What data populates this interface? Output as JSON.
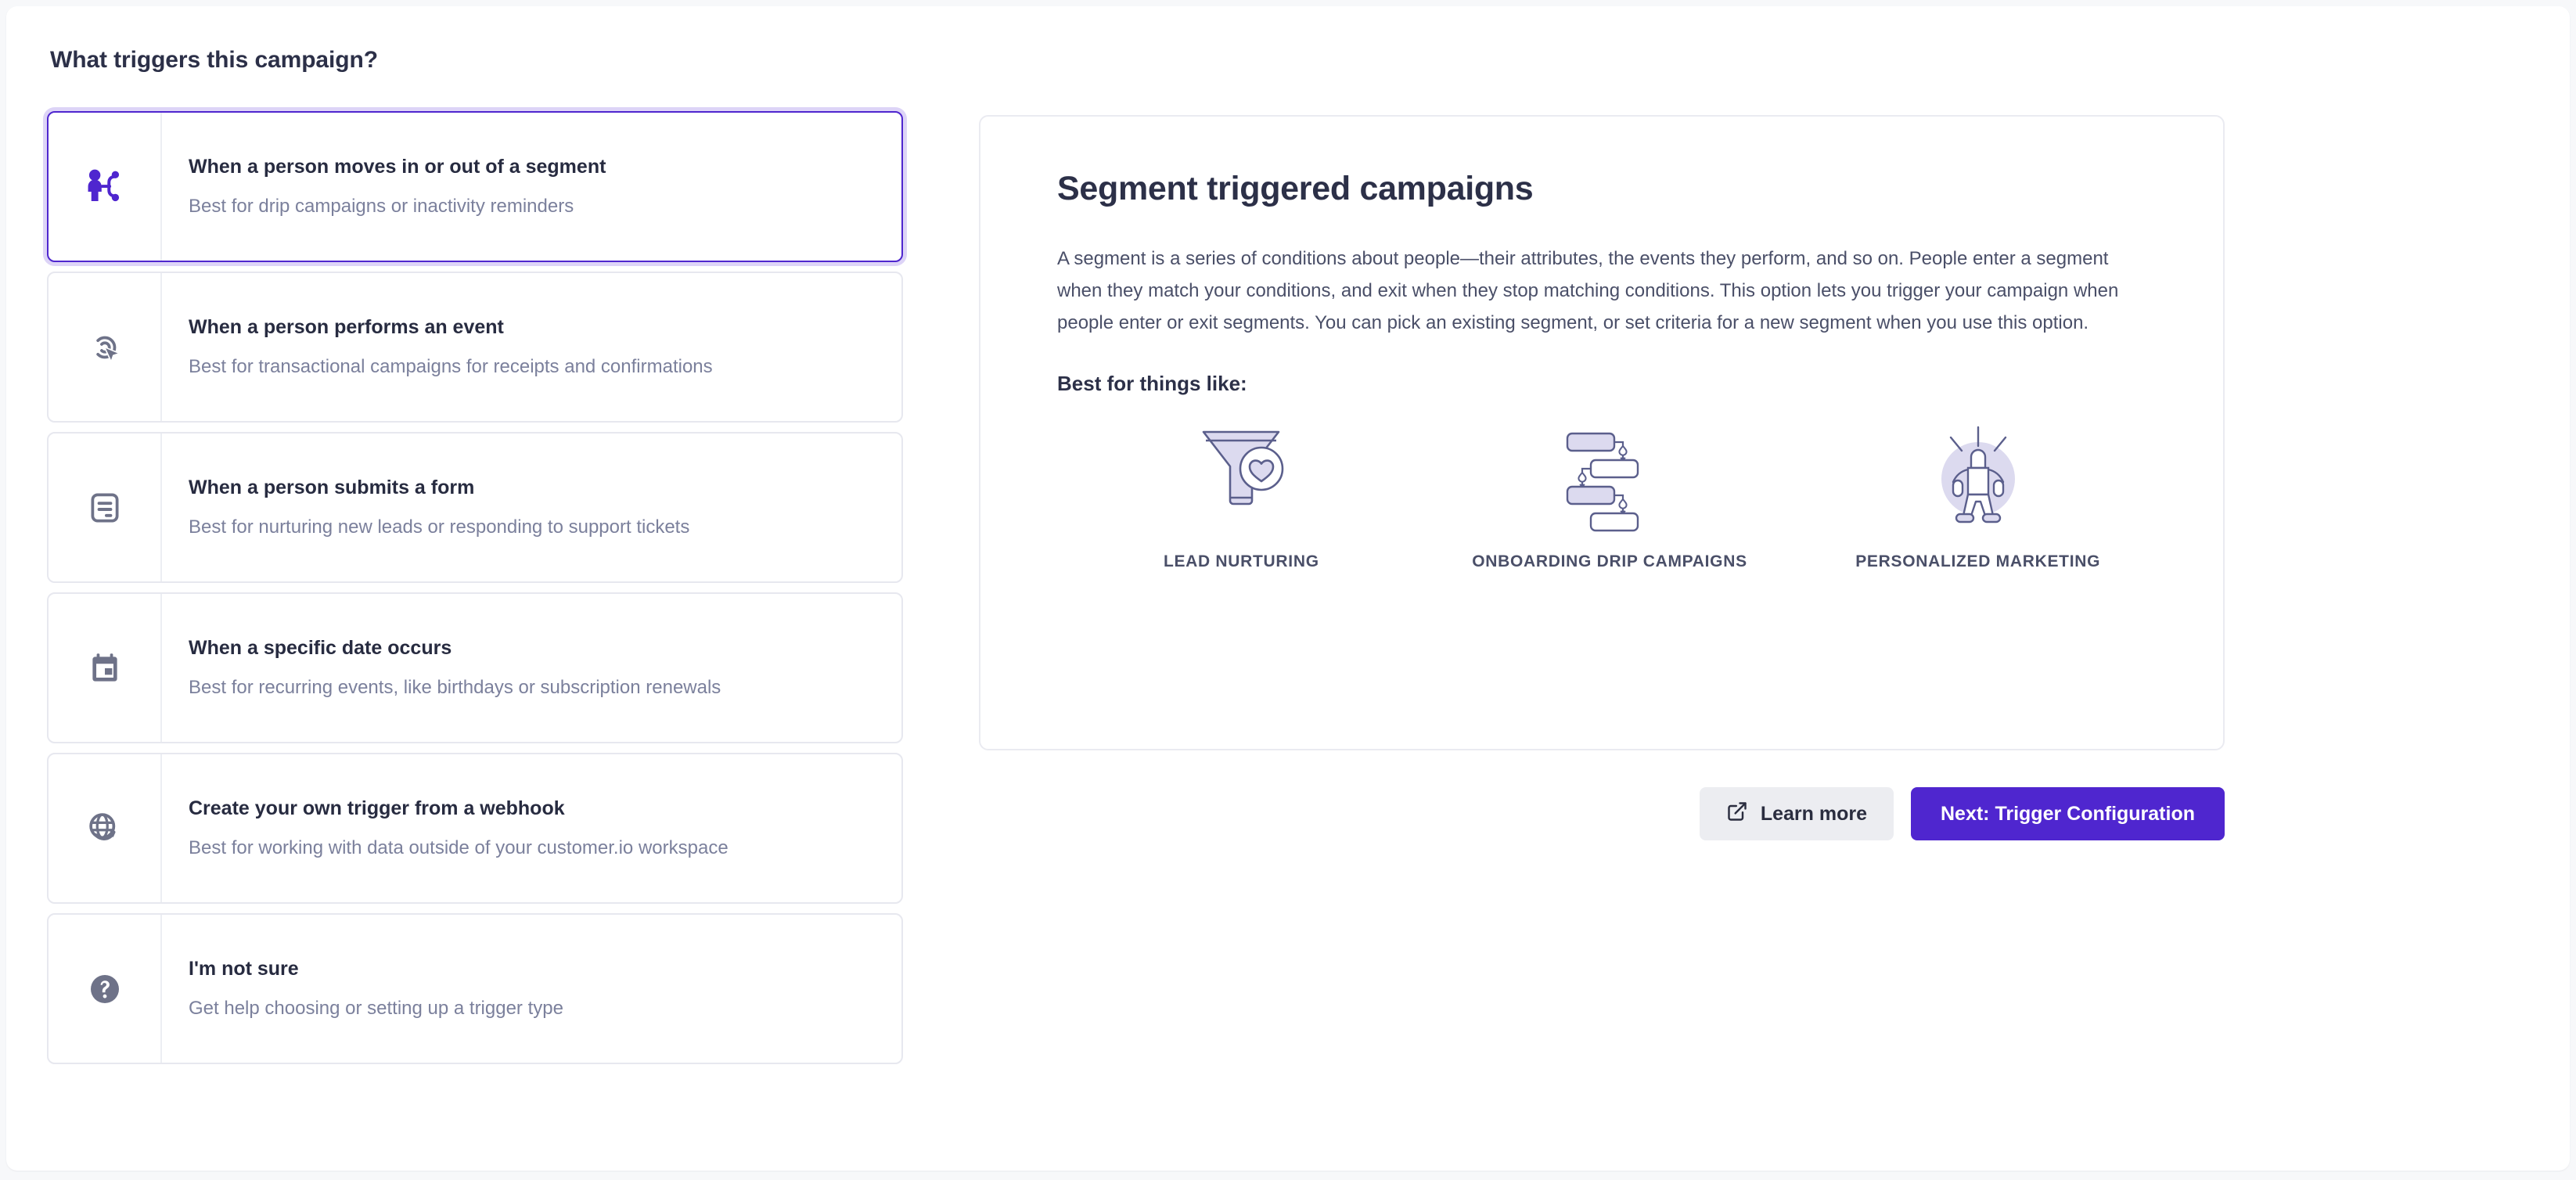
{
  "page": {
    "title": "What triggers this campaign?"
  },
  "options": [
    {
      "id": "segment",
      "icon": "person-segment-icon",
      "title": "When a person moves in or out of a segment",
      "subtitle": "Best for drip campaigns or inactivity reminders",
      "selected": true
    },
    {
      "id": "event",
      "icon": "cursor-click-icon",
      "title": "When a person performs an event",
      "subtitle": "Best for transactional campaigns for receipts and confirmations",
      "selected": false
    },
    {
      "id": "form",
      "icon": "form-document-icon",
      "title": "When a person submits a form",
      "subtitle": "Best for nurturing new leads or responding to support tickets",
      "selected": false
    },
    {
      "id": "date",
      "icon": "calendar-icon",
      "title": "When a specific date occurs",
      "subtitle": "Best for recurring events, like birthdays or subscription renewals",
      "selected": false
    },
    {
      "id": "webhook",
      "icon": "globe-refresh-icon",
      "title": "Create your own trigger from a webhook",
      "subtitle": "Best for working with data outside of your customer.io workspace",
      "selected": false
    },
    {
      "id": "unsure",
      "icon": "question-mark-icon",
      "title": "I'm not sure",
      "subtitle": "Get help choosing or setting up a trigger type",
      "selected": false
    }
  ],
  "detail": {
    "title": "Segment triggered campaigns",
    "paragraph": "A segment is a series of conditions about people—their attributes, the events they perform, and so on. People enter a segment when they match your conditions, and exit when they stop matching conditions. This option lets you trigger your campaign when people enter or exit segments. You can pick an existing segment, or set criteria for a new segment when you use this option.",
    "best_for_label": "Best for things like:",
    "use_cases": [
      {
        "icon": "funnel-heart-illustration",
        "label": "LEAD NURTURING"
      },
      {
        "icon": "workflow-blocks-illustration",
        "label": "ONBOARDING DRIP CAMPAIGNS"
      },
      {
        "icon": "person-spotlight-illustration",
        "label": "PERSONALIZED MARKETING"
      }
    ]
  },
  "actions": {
    "learn_more_label": "Learn more",
    "learn_more_icon": "external-link-icon",
    "next_label": "Next: Trigger Configuration"
  },
  "colors": {
    "accent": "#4f26cf",
    "selected_ring": "#ddd4f7",
    "icon_muted": "#6e7288",
    "text_primary": "#272b40",
    "text_muted": "#7b809c",
    "illustration_fill": "#dcdaef",
    "illustration_stroke": "#5b5f8c"
  }
}
